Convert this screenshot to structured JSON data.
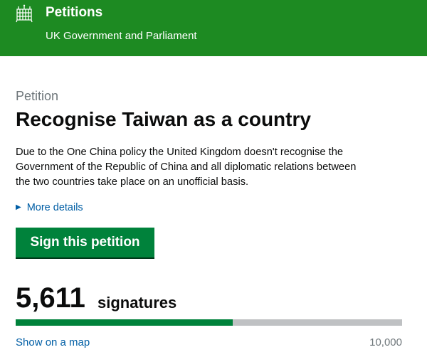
{
  "header": {
    "title": "Petitions",
    "subtitle": "UK Government and Parliament",
    "crest_icon": "portcullis-icon"
  },
  "petition": {
    "kicker": "Petition",
    "title": "Recognise Taiwan as a country",
    "description_lines": [
      "Due to the One China policy the United Kingdom doesn't recognise the",
      "Government of the Republic of China and all diplomatic relations between",
      "the two countries take place on an unofficial basis."
    ],
    "more_details_label": "More details",
    "sign_button_label": "Sign this petition"
  },
  "signatures": {
    "count_display": "5,611",
    "label": "signatures",
    "count": 5611,
    "target": 10000,
    "target_display": "10,000",
    "map_link_label": "Show on a map"
  },
  "colors": {
    "header_bg": "#1d8a22",
    "button_bg": "#00823b",
    "progress_fill": "#00823b",
    "progress_track": "#bfc1c3",
    "link": "#005ea5"
  }
}
